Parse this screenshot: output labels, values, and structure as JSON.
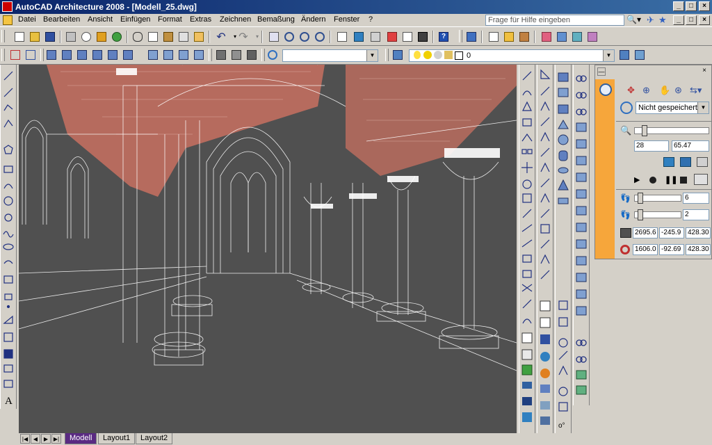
{
  "window": {
    "title": "AutoCAD Architecture 2008 - [Modell_25.dwg]",
    "min_label": "_",
    "max_label": "□",
    "close_label": "×"
  },
  "menu": [
    "Datei",
    "Bearbeiten",
    "Ansicht",
    "Einfügen",
    "Format",
    "Extras",
    "Zeichnen",
    "Bemaßung",
    "Ändern",
    "Fenster",
    "?"
  ],
  "help": {
    "placeholder": "Frage für Hilfe eingeben"
  },
  "layer_combo": {
    "value": "0"
  },
  "tabs": [
    "Modell",
    "Layout1",
    "Layout2"
  ],
  "tab_nav_glyphs": [
    "|◀",
    "◀",
    "▶",
    "▶|"
  ],
  "nav_panel": {
    "view_combo": "Nicht gespeichert",
    "zoom_min": "28",
    "zoom_max": "65.47",
    "step_count": "6",
    "step_height": "2",
    "camera": {
      "x": "2695.6",
      "y": "-245.9",
      "z": "428.30"
    },
    "target": {
      "x": "1606.0",
      "y": "-92.69",
      "z": "428.30"
    }
  },
  "colors": {
    "title_start": "#0a246a",
    "title_end": "#3a6ea5",
    "viewport_bg": "#505050",
    "ceiling": "#c87060",
    "panel_accent": "#f6a63b",
    "active_tab": "#5a2a82"
  }
}
